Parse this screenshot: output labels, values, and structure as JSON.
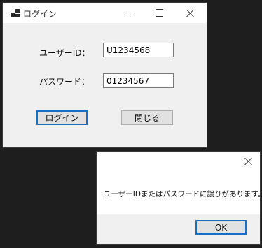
{
  "login_window": {
    "title": "ログイン",
    "user_id_label": "ユーザーID：",
    "user_id_value": "U1234568",
    "password_label": "パスワード：",
    "password_value": "01234567",
    "login_button": "ログイン",
    "close_button": "閉じる",
    "icons": {
      "app": "app-icon",
      "minimize": "minimize-icon",
      "maximize": "maximize-icon",
      "close": "close-icon"
    }
  },
  "message_box": {
    "text": "ユーザーIDまたはパスワードに誤りがあります。",
    "ok_button": "OK",
    "icons": {
      "close": "close-icon"
    }
  },
  "colors": {
    "accent": "#1a6fc4",
    "window_bg": "#f0f0f0",
    "desktop_bg": "#1e1e1e"
  }
}
